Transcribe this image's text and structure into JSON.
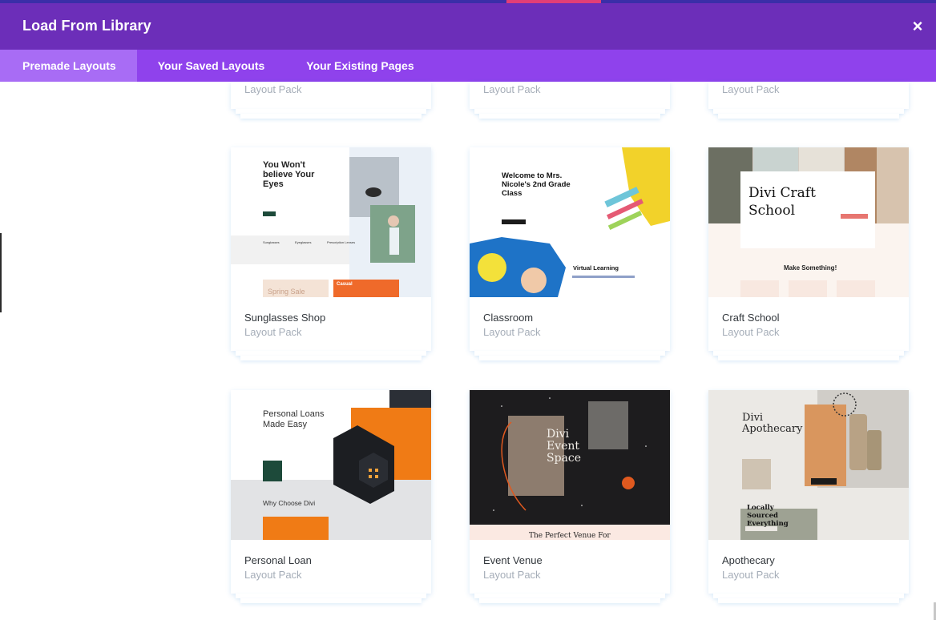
{
  "modal": {
    "title": "Load From Library",
    "close_label": "×"
  },
  "tabs": [
    {
      "label": "Premade Layouts",
      "active": true
    },
    {
      "label": "Your Saved Layouts",
      "active": false
    },
    {
      "label": "Your Existing Pages",
      "active": false
    }
  ],
  "top_row": [
    {
      "sub": "Layout Pack"
    },
    {
      "sub": "Layout Pack"
    },
    {
      "sub": "Layout Pack"
    }
  ],
  "layouts": [
    {
      "name": "Sunglasses Shop",
      "sub": "Layout Pack",
      "thumb": {
        "headline": "You Won't believe Your Eyes",
        "col1": "Sunglasses",
        "col2": "Eyeglasses",
        "col3": "Prescription Lenses",
        "banner1": "Spring Sale",
        "banner2": "Casual"
      }
    },
    {
      "name": "Classroom",
      "sub": "Layout Pack",
      "thumb": {
        "headline": "Welcome to Mrs. Nicole's 2nd Grade Class",
        "section": "Virtual Learning"
      }
    },
    {
      "name": "Craft School",
      "sub": "Layout Pack",
      "thumb": {
        "headline": "Divi Craft School",
        "section": "Make Something!"
      }
    },
    {
      "name": "Personal Loan",
      "sub": "Layout Pack",
      "thumb": {
        "headline": "Personal Loans Made Easy",
        "section": "Why Choose Divi"
      }
    },
    {
      "name": "Event Venue",
      "sub": "Layout Pack",
      "thumb": {
        "headline": "Divi Event Space",
        "section": "The Perfect Venue For"
      }
    },
    {
      "name": "Apothecary",
      "sub": "Layout Pack",
      "thumb": {
        "headline": "Divi Apothecary",
        "section": "Locally Sourced Everything"
      }
    }
  ],
  "colors": {
    "header": "#6c2eb9",
    "tabs": "#8f42ec",
    "tab_active": "#a86cf5",
    "card_title": "#32373c",
    "card_sub": "#a5adb8"
  }
}
